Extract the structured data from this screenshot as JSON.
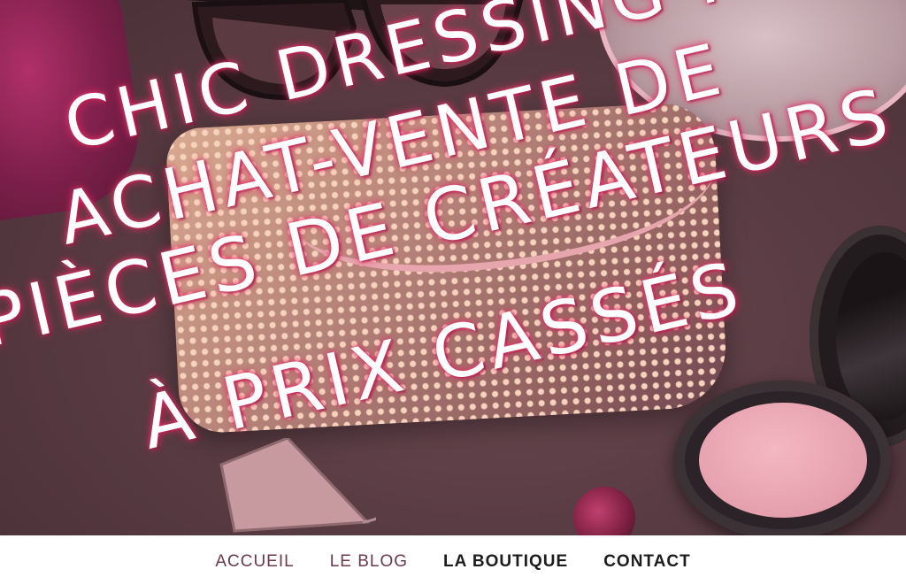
{
  "hero": {
    "title_lines": [
      "CHIC DRESSING :",
      "ACHAT-VENTE DE",
      "PIÈCES DE CRÉATEURS",
      "À PRIX CASSÉS"
    ]
  },
  "nav": {
    "items": [
      {
        "label": "ACCUEIL",
        "color": "#6b3a48"
      },
      {
        "label": "LE BLOG",
        "color": "#6b3a48"
      },
      {
        "label": "LA BOUTIQUE",
        "color": "#1c1c1c"
      },
      {
        "label": "CONTACT",
        "color": "#1c1c1c"
      }
    ]
  },
  "colors": {
    "title_glow": "#e83068",
    "title_text": "#ffffff",
    "background": "#5a3c44"
  }
}
